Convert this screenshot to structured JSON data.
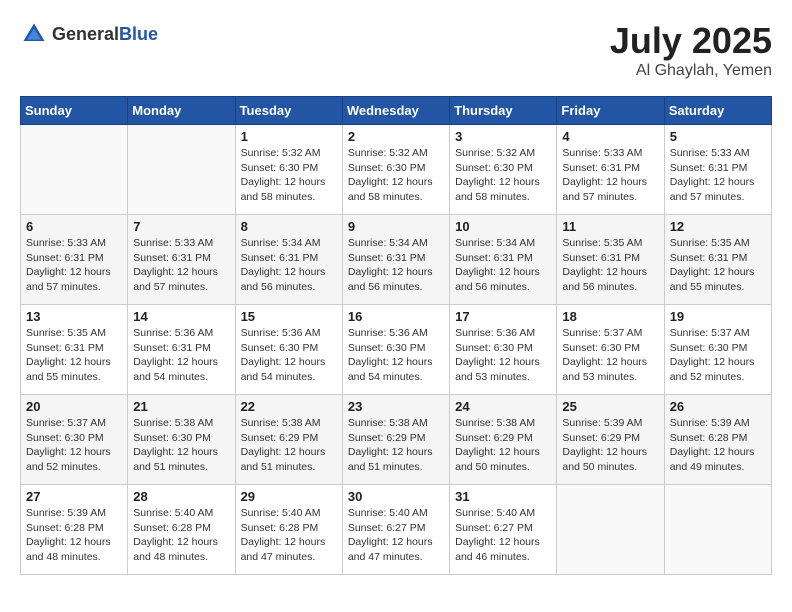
{
  "header": {
    "logo_general": "General",
    "logo_blue": "Blue",
    "title": "July 2025",
    "location": "Al Ghaylah, Yemen"
  },
  "calendar": {
    "days_of_week": [
      "Sunday",
      "Monday",
      "Tuesday",
      "Wednesday",
      "Thursday",
      "Friday",
      "Saturday"
    ],
    "weeks": [
      [
        {
          "day": "",
          "detail": ""
        },
        {
          "day": "",
          "detail": ""
        },
        {
          "day": "1",
          "detail": "Sunrise: 5:32 AM\nSunset: 6:30 PM\nDaylight: 12 hours\nand 58 minutes."
        },
        {
          "day": "2",
          "detail": "Sunrise: 5:32 AM\nSunset: 6:30 PM\nDaylight: 12 hours\nand 58 minutes."
        },
        {
          "day": "3",
          "detail": "Sunrise: 5:32 AM\nSunset: 6:30 PM\nDaylight: 12 hours\nand 58 minutes."
        },
        {
          "day": "4",
          "detail": "Sunrise: 5:33 AM\nSunset: 6:31 PM\nDaylight: 12 hours\nand 57 minutes."
        },
        {
          "day": "5",
          "detail": "Sunrise: 5:33 AM\nSunset: 6:31 PM\nDaylight: 12 hours\nand 57 minutes."
        }
      ],
      [
        {
          "day": "6",
          "detail": "Sunrise: 5:33 AM\nSunset: 6:31 PM\nDaylight: 12 hours\nand 57 minutes."
        },
        {
          "day": "7",
          "detail": "Sunrise: 5:33 AM\nSunset: 6:31 PM\nDaylight: 12 hours\nand 57 minutes."
        },
        {
          "day": "8",
          "detail": "Sunrise: 5:34 AM\nSunset: 6:31 PM\nDaylight: 12 hours\nand 56 minutes."
        },
        {
          "day": "9",
          "detail": "Sunrise: 5:34 AM\nSunset: 6:31 PM\nDaylight: 12 hours\nand 56 minutes."
        },
        {
          "day": "10",
          "detail": "Sunrise: 5:34 AM\nSunset: 6:31 PM\nDaylight: 12 hours\nand 56 minutes."
        },
        {
          "day": "11",
          "detail": "Sunrise: 5:35 AM\nSunset: 6:31 PM\nDaylight: 12 hours\nand 56 minutes."
        },
        {
          "day": "12",
          "detail": "Sunrise: 5:35 AM\nSunset: 6:31 PM\nDaylight: 12 hours\nand 55 minutes."
        }
      ],
      [
        {
          "day": "13",
          "detail": "Sunrise: 5:35 AM\nSunset: 6:31 PM\nDaylight: 12 hours\nand 55 minutes."
        },
        {
          "day": "14",
          "detail": "Sunrise: 5:36 AM\nSunset: 6:31 PM\nDaylight: 12 hours\nand 54 minutes."
        },
        {
          "day": "15",
          "detail": "Sunrise: 5:36 AM\nSunset: 6:30 PM\nDaylight: 12 hours\nand 54 minutes."
        },
        {
          "day": "16",
          "detail": "Sunrise: 5:36 AM\nSunset: 6:30 PM\nDaylight: 12 hours\nand 54 minutes."
        },
        {
          "day": "17",
          "detail": "Sunrise: 5:36 AM\nSunset: 6:30 PM\nDaylight: 12 hours\nand 53 minutes."
        },
        {
          "day": "18",
          "detail": "Sunrise: 5:37 AM\nSunset: 6:30 PM\nDaylight: 12 hours\nand 53 minutes."
        },
        {
          "day": "19",
          "detail": "Sunrise: 5:37 AM\nSunset: 6:30 PM\nDaylight: 12 hours\nand 52 minutes."
        }
      ],
      [
        {
          "day": "20",
          "detail": "Sunrise: 5:37 AM\nSunset: 6:30 PM\nDaylight: 12 hours\nand 52 minutes."
        },
        {
          "day": "21",
          "detail": "Sunrise: 5:38 AM\nSunset: 6:30 PM\nDaylight: 12 hours\nand 51 minutes."
        },
        {
          "day": "22",
          "detail": "Sunrise: 5:38 AM\nSunset: 6:29 PM\nDaylight: 12 hours\nand 51 minutes."
        },
        {
          "day": "23",
          "detail": "Sunrise: 5:38 AM\nSunset: 6:29 PM\nDaylight: 12 hours\nand 51 minutes."
        },
        {
          "day": "24",
          "detail": "Sunrise: 5:38 AM\nSunset: 6:29 PM\nDaylight: 12 hours\nand 50 minutes."
        },
        {
          "day": "25",
          "detail": "Sunrise: 5:39 AM\nSunset: 6:29 PM\nDaylight: 12 hours\nand 50 minutes."
        },
        {
          "day": "26",
          "detail": "Sunrise: 5:39 AM\nSunset: 6:28 PM\nDaylight: 12 hours\nand 49 minutes."
        }
      ],
      [
        {
          "day": "27",
          "detail": "Sunrise: 5:39 AM\nSunset: 6:28 PM\nDaylight: 12 hours\nand 48 minutes."
        },
        {
          "day": "28",
          "detail": "Sunrise: 5:40 AM\nSunset: 6:28 PM\nDaylight: 12 hours\nand 48 minutes."
        },
        {
          "day": "29",
          "detail": "Sunrise: 5:40 AM\nSunset: 6:28 PM\nDaylight: 12 hours\nand 47 minutes."
        },
        {
          "day": "30",
          "detail": "Sunrise: 5:40 AM\nSunset: 6:27 PM\nDaylight: 12 hours\nand 47 minutes."
        },
        {
          "day": "31",
          "detail": "Sunrise: 5:40 AM\nSunset: 6:27 PM\nDaylight: 12 hours\nand 46 minutes."
        },
        {
          "day": "",
          "detail": ""
        },
        {
          "day": "",
          "detail": ""
        }
      ]
    ]
  }
}
